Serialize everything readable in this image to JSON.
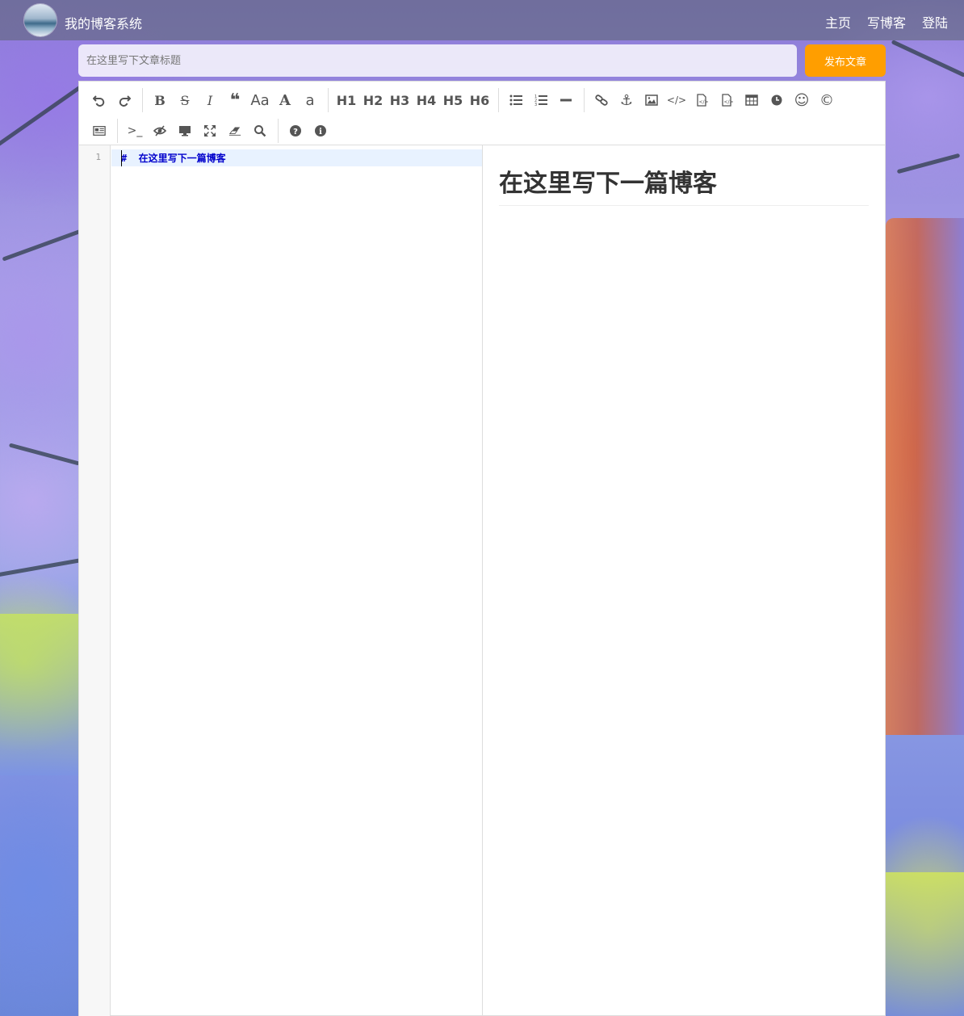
{
  "nav": {
    "site_title": "我的博客系统",
    "links": [
      "主页",
      "写博客",
      "登陆"
    ]
  },
  "title_input": {
    "placeholder": "在这里写下文章标题",
    "value": ""
  },
  "publish_button": "发布文章",
  "colors": {
    "publish": "#ff9e00",
    "code_heading": "#0000cc"
  },
  "toolbar": {
    "row1": [
      {
        "icon": "undo-icon"
      },
      {
        "icon": "redo-icon"
      },
      {
        "sep": true
      },
      {
        "label": "B",
        "icon": "bold-icon"
      },
      {
        "label": "S",
        "icon": "strikethrough-icon"
      },
      {
        "label": "I",
        "icon": "italic-icon"
      },
      {
        "icon": "quote-icon"
      },
      {
        "label": "Aa",
        "icon": "uppercase-icon"
      },
      {
        "label": "A",
        "icon": "ucfirst-icon"
      },
      {
        "label": "a",
        "icon": "lowercase-icon"
      },
      {
        "sep": true
      },
      {
        "label": "H1"
      },
      {
        "label": "H2"
      },
      {
        "label": "H3"
      },
      {
        "label": "H4"
      },
      {
        "label": "H5"
      },
      {
        "label": "H6"
      },
      {
        "sep": true
      },
      {
        "icon": "unordered-list-icon"
      },
      {
        "icon": "ordered-list-icon"
      },
      {
        "icon": "horizontal-rule-icon"
      },
      {
        "sep": true
      },
      {
        "icon": "link-icon"
      },
      {
        "icon": "anchor-icon"
      },
      {
        "icon": "image-icon"
      },
      {
        "icon": "code-icon"
      },
      {
        "icon": "preformatted-code-icon"
      },
      {
        "icon": "code-block-icon"
      },
      {
        "icon": "table-icon"
      },
      {
        "icon": "datetime-icon"
      },
      {
        "icon": "emoji-icon"
      },
      {
        "icon": "html-entities-icon"
      }
    ],
    "row2": [
      {
        "icon": "pagebreak-icon"
      },
      {
        "sep": true
      },
      {
        "icon": "goto-line-icon"
      },
      {
        "icon": "watch-icon"
      },
      {
        "icon": "preview-icon"
      },
      {
        "icon": "fullscreen-icon"
      },
      {
        "icon": "clear-icon"
      },
      {
        "icon": "search-icon"
      },
      {
        "sep": true
      },
      {
        "icon": "help-icon"
      },
      {
        "icon": "info-icon"
      }
    ]
  },
  "editor": {
    "line_number": "1",
    "code_line": "#  在这里写下一篇博客"
  },
  "preview": {
    "heading": "在这里写下一篇博客"
  }
}
